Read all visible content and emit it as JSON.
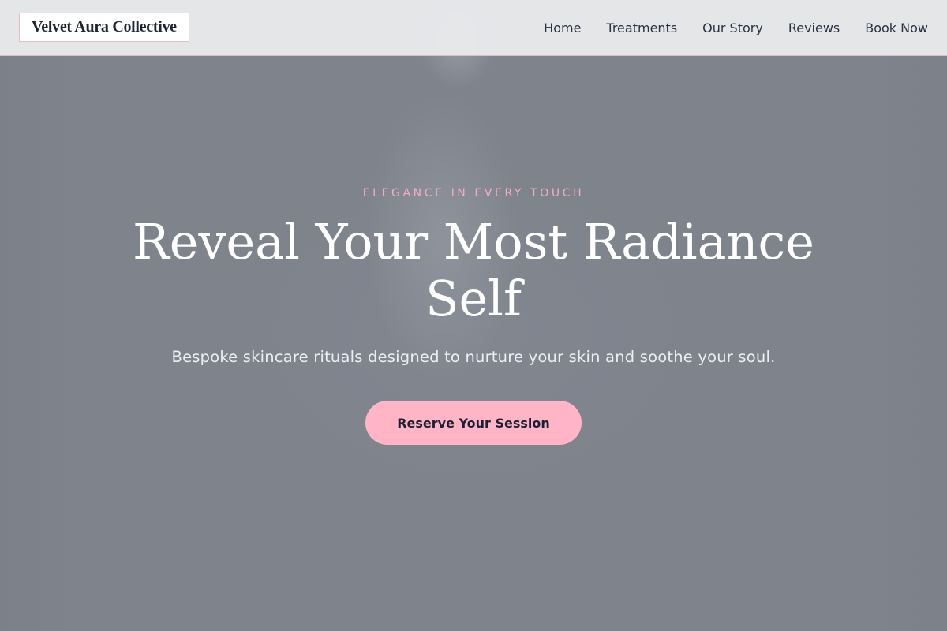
{
  "brand": {
    "name": "Velvet Aura Collective"
  },
  "nav": {
    "items": [
      {
        "label": "Home"
      },
      {
        "label": "Treatments"
      },
      {
        "label": "Our Story"
      },
      {
        "label": "Reviews"
      },
      {
        "label": "Book Now"
      }
    ]
  },
  "hero": {
    "eyebrow": "ELEGANCE IN EVERY TOUCH",
    "headline": "Reveal Your Most Radiance Self",
    "subheadline": "Bespoke skincare rituals designed to nurture your skin and soothe your soul.",
    "cta_label": "Reserve Your Session"
  },
  "colors": {
    "accent_pink": "#ffb5c6",
    "eyebrow_pink": "#f4aec0",
    "header_bg": "#e8e9eb",
    "hero_overlay": "#7e838c",
    "text_dark": "#1f2433"
  }
}
